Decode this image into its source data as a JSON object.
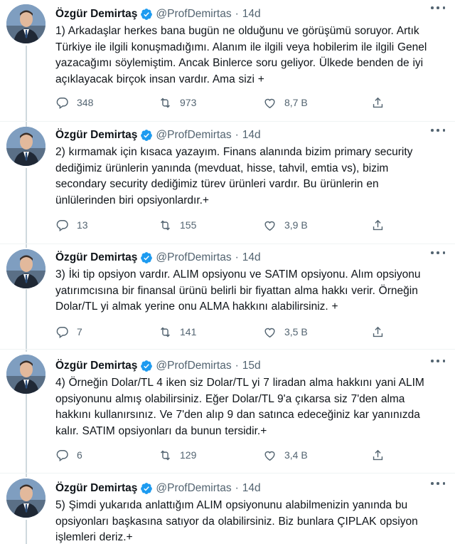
{
  "author": {
    "name": "Özgür Demirtaş",
    "handle": "@ProfDemirtas",
    "separator": "·"
  },
  "icons": {
    "reply": "reply-icon",
    "retweet": "retweet-icon",
    "like": "like-icon",
    "share": "share-icon",
    "verified": "verified-badge-icon",
    "more": "more-options-icon"
  },
  "colors": {
    "verified": "#1d9bf0",
    "text": "#0f1419",
    "muted": "#536471",
    "line": "#cfd9de"
  },
  "tweets": [
    {
      "time": "14d",
      "lines": [
        "1) Arkadaşlar herkes bana bugün ne olduğunu ve görüşümü soruyor. Artık",
        "Türkiye ile ilgili konuşmadığımı. Alanım ile ilgili veya hobilerim ile ilgili Genel",
        "yazacağımı söylemiştim. Ancak Binlerce soru geliyor. Ülkede benden de iyi",
        "açıklayacak birçok insan vardır. Ama sizi +"
      ],
      "replies": "348",
      "retweets": "973",
      "likes": "8,7 B"
    },
    {
      "time": "14d",
      "lines": [
        "2) kırmamak için kısaca yazayım. Finans alanında bizim primary security",
        "dediğimiz ürünlerin yanında (mevduat, hisse, tahvil, emtia vs), bizim",
        "secondary security dediğimiz türev ürünleri vardır. Bu ürünlerin en",
        "ünlülerinden biri opsiyonlardır.+"
      ],
      "replies": "13",
      "retweets": "155",
      "likes": "3,9 B"
    },
    {
      "time": "14d",
      "lines": [
        "3) İki tip opsiyon vardır. ALIM opsiyonu ve SATIM opsiyonu. Alım opsiyonu",
        "yatırımcısına bir finansal ürünü belirli bir fiyattan alma hakkı verir. Örneğin",
        "Dolar/TL yi almak yerine onu ALMA hakkını alabilirsiniz. +"
      ],
      "replies": "7",
      "retweets": "141",
      "likes": "3,5 B"
    },
    {
      "time": "15d",
      "lines": [
        "4) Örneğin Dolar/TL 4 iken siz Dolar/TL yi 7 liradan alma hakkını yani ALIM",
        "opsiyonunu almış olabilirsiniz. Eğer Dolar/TL 9'a çıkarsa siz 7'den alma",
        "hakkını kullanırsınız. Ve 7'den alıp 9 dan satınca edeceğiniz kar yanınızda",
        "kalır. SATIM opsiyonları da bunun tersidir.+"
      ],
      "replies": "6",
      "retweets": "129",
      "likes": "3,4 B"
    },
    {
      "time": "14d",
      "lines": [
        "5) Şimdi yukarıda anlattığım ALIM opsiyonunu alabilmenizin yanında bu",
        "opsiyonları başkasına satıyor da olabilirsiniz. Biz bunlara ÇIPLAK opsiyon",
        "işlemleri deriz.+"
      ]
    }
  ]
}
